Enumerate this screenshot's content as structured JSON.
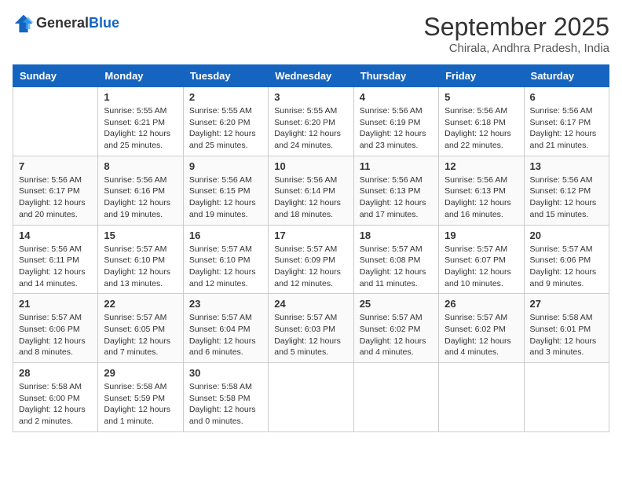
{
  "header": {
    "logo_line1": "General",
    "logo_line2": "Blue",
    "month_title": "September 2025",
    "location": "Chirala, Andhra Pradesh, India"
  },
  "columns": [
    "Sunday",
    "Monday",
    "Tuesday",
    "Wednesday",
    "Thursday",
    "Friday",
    "Saturday"
  ],
  "weeks": [
    [
      {
        "day": "",
        "info": ""
      },
      {
        "day": "1",
        "info": "Sunrise: 5:55 AM\nSunset: 6:21 PM\nDaylight: 12 hours\nand 25 minutes."
      },
      {
        "day": "2",
        "info": "Sunrise: 5:55 AM\nSunset: 6:20 PM\nDaylight: 12 hours\nand 25 minutes."
      },
      {
        "day": "3",
        "info": "Sunrise: 5:55 AM\nSunset: 6:20 PM\nDaylight: 12 hours\nand 24 minutes."
      },
      {
        "day": "4",
        "info": "Sunrise: 5:56 AM\nSunset: 6:19 PM\nDaylight: 12 hours\nand 23 minutes."
      },
      {
        "day": "5",
        "info": "Sunrise: 5:56 AM\nSunset: 6:18 PM\nDaylight: 12 hours\nand 22 minutes."
      },
      {
        "day": "6",
        "info": "Sunrise: 5:56 AM\nSunset: 6:17 PM\nDaylight: 12 hours\nand 21 minutes."
      }
    ],
    [
      {
        "day": "7",
        "info": "Sunrise: 5:56 AM\nSunset: 6:17 PM\nDaylight: 12 hours\nand 20 minutes."
      },
      {
        "day": "8",
        "info": "Sunrise: 5:56 AM\nSunset: 6:16 PM\nDaylight: 12 hours\nand 19 minutes."
      },
      {
        "day": "9",
        "info": "Sunrise: 5:56 AM\nSunset: 6:15 PM\nDaylight: 12 hours\nand 19 minutes."
      },
      {
        "day": "10",
        "info": "Sunrise: 5:56 AM\nSunset: 6:14 PM\nDaylight: 12 hours\nand 18 minutes."
      },
      {
        "day": "11",
        "info": "Sunrise: 5:56 AM\nSunset: 6:13 PM\nDaylight: 12 hours\nand 17 minutes."
      },
      {
        "day": "12",
        "info": "Sunrise: 5:56 AM\nSunset: 6:13 PM\nDaylight: 12 hours\nand 16 minutes."
      },
      {
        "day": "13",
        "info": "Sunrise: 5:56 AM\nSunset: 6:12 PM\nDaylight: 12 hours\nand 15 minutes."
      }
    ],
    [
      {
        "day": "14",
        "info": "Sunrise: 5:56 AM\nSunset: 6:11 PM\nDaylight: 12 hours\nand 14 minutes."
      },
      {
        "day": "15",
        "info": "Sunrise: 5:57 AM\nSunset: 6:10 PM\nDaylight: 12 hours\nand 13 minutes."
      },
      {
        "day": "16",
        "info": "Sunrise: 5:57 AM\nSunset: 6:10 PM\nDaylight: 12 hours\nand 12 minutes."
      },
      {
        "day": "17",
        "info": "Sunrise: 5:57 AM\nSunset: 6:09 PM\nDaylight: 12 hours\nand 12 minutes."
      },
      {
        "day": "18",
        "info": "Sunrise: 5:57 AM\nSunset: 6:08 PM\nDaylight: 12 hours\nand 11 minutes."
      },
      {
        "day": "19",
        "info": "Sunrise: 5:57 AM\nSunset: 6:07 PM\nDaylight: 12 hours\nand 10 minutes."
      },
      {
        "day": "20",
        "info": "Sunrise: 5:57 AM\nSunset: 6:06 PM\nDaylight: 12 hours\nand 9 minutes."
      }
    ],
    [
      {
        "day": "21",
        "info": "Sunrise: 5:57 AM\nSunset: 6:06 PM\nDaylight: 12 hours\nand 8 minutes."
      },
      {
        "day": "22",
        "info": "Sunrise: 5:57 AM\nSunset: 6:05 PM\nDaylight: 12 hours\nand 7 minutes."
      },
      {
        "day": "23",
        "info": "Sunrise: 5:57 AM\nSunset: 6:04 PM\nDaylight: 12 hours\nand 6 minutes."
      },
      {
        "day": "24",
        "info": "Sunrise: 5:57 AM\nSunset: 6:03 PM\nDaylight: 12 hours\nand 5 minutes."
      },
      {
        "day": "25",
        "info": "Sunrise: 5:57 AM\nSunset: 6:02 PM\nDaylight: 12 hours\nand 4 minutes."
      },
      {
        "day": "26",
        "info": "Sunrise: 5:57 AM\nSunset: 6:02 PM\nDaylight: 12 hours\nand 4 minutes."
      },
      {
        "day": "27",
        "info": "Sunrise: 5:58 AM\nSunset: 6:01 PM\nDaylight: 12 hours\nand 3 minutes."
      }
    ],
    [
      {
        "day": "28",
        "info": "Sunrise: 5:58 AM\nSunset: 6:00 PM\nDaylight: 12 hours\nand 2 minutes."
      },
      {
        "day": "29",
        "info": "Sunrise: 5:58 AM\nSunset: 5:59 PM\nDaylight: 12 hours\nand 1 minute."
      },
      {
        "day": "30",
        "info": "Sunrise: 5:58 AM\nSunset: 5:58 PM\nDaylight: 12 hours\nand 0 minutes."
      },
      {
        "day": "",
        "info": ""
      },
      {
        "day": "",
        "info": ""
      },
      {
        "day": "",
        "info": ""
      },
      {
        "day": "",
        "info": ""
      }
    ]
  ]
}
